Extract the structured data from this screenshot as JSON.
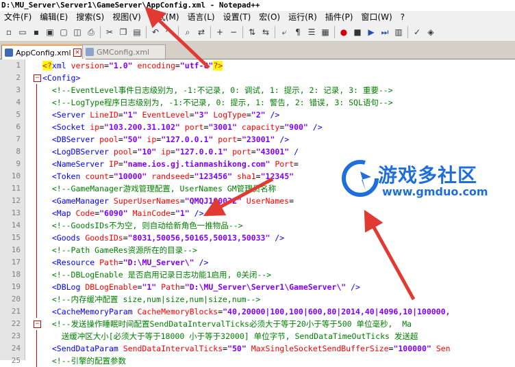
{
  "window": {
    "title": "D:\\MU_Server\\Server1\\GameServer\\AppConfig.xml - Notepad++"
  },
  "menu": [
    {
      "id": "file",
      "label": "文件(F)"
    },
    {
      "id": "edit",
      "label": "编辑(E)"
    },
    {
      "id": "search",
      "label": "搜索(S)"
    },
    {
      "id": "view",
      "label": "视图(V)"
    },
    {
      "id": "format",
      "label": "格式(M)"
    },
    {
      "id": "language",
      "label": "语言(L)"
    },
    {
      "id": "settings",
      "label": "设置(T)"
    },
    {
      "id": "macro",
      "label": "宏(O)"
    },
    {
      "id": "run",
      "label": "运行(R)"
    },
    {
      "id": "plugins",
      "label": "插件(P)"
    },
    {
      "id": "window",
      "label": "窗口(W)"
    },
    {
      "id": "help",
      "label": "?"
    }
  ],
  "tabs": [
    {
      "label": "AppConfig.xml",
      "active": true
    },
    {
      "label": "GMConfig.xml",
      "active": false
    }
  ],
  "lines": [
    {
      "n": "1",
      "fold": "",
      "segs": [
        [
          "pi",
          "<?"
        ],
        [
          "tag",
          "xml "
        ],
        [
          "attr",
          "version"
        ],
        [
          "txt",
          "="
        ],
        [
          "val",
          "\"1.0\""
        ],
        [
          "txt",
          " "
        ],
        [
          "attr",
          "encoding"
        ],
        [
          "txt",
          "="
        ],
        [
          "val",
          "\"utf-8\""
        ],
        [
          "pi",
          "?>"
        ]
      ]
    },
    {
      "n": "2",
      "fold": "minus",
      "segs": [
        [
          "tag",
          "<Config>"
        ]
      ]
    },
    {
      "n": "3",
      "fold": "line",
      "segs": [
        [
          "txt",
          "  "
        ],
        [
          "cmt",
          "<!--EventLevel事件日志级别为, -1:不记录, 0: 调试, 1: 提示, 2: 记录, 3: 重要-->"
        ]
      ]
    },
    {
      "n": "4",
      "fold": "line",
      "segs": [
        [
          "txt",
          "  "
        ],
        [
          "cmt",
          "<!--LogType程序日志级别为, -1:不记录, 0: 提示, 1: 警告, 2: 错误, 3: SQL语句-->"
        ]
      ]
    },
    {
      "n": "5",
      "fold": "line",
      "segs": [
        [
          "txt",
          "  "
        ],
        [
          "tag",
          "<Server "
        ],
        [
          "attr",
          "LineID"
        ],
        [
          "txt",
          "="
        ],
        [
          "val",
          "\"1\""
        ],
        [
          "txt",
          " "
        ],
        [
          "attr",
          "EventLevel"
        ],
        [
          "txt",
          "="
        ],
        [
          "val",
          "\"3\""
        ],
        [
          "txt",
          " "
        ],
        [
          "attr",
          "LogType"
        ],
        [
          "txt",
          "="
        ],
        [
          "val",
          "\"2\""
        ],
        [
          "tag",
          " />"
        ]
      ]
    },
    {
      "n": "6",
      "fold": "line",
      "segs": [
        [
          "txt",
          "  "
        ],
        [
          "tag",
          "<Socket "
        ],
        [
          "attr",
          "ip"
        ],
        [
          "txt",
          "="
        ],
        [
          "val",
          "\"103.200.31.102\""
        ],
        [
          "txt",
          " "
        ],
        [
          "attr",
          "port"
        ],
        [
          "txt",
          "="
        ],
        [
          "val",
          "\"3001\""
        ],
        [
          "txt",
          " "
        ],
        [
          "attr",
          "capacity"
        ],
        [
          "txt",
          "="
        ],
        [
          "val",
          "\"900\""
        ],
        [
          "tag",
          " />"
        ]
      ]
    },
    {
      "n": "7",
      "fold": "line",
      "segs": [
        [
          "txt",
          "  "
        ],
        [
          "tag",
          "<DBServer "
        ],
        [
          "attr",
          "pool"
        ],
        [
          "txt",
          "="
        ],
        [
          "val",
          "\"50\""
        ],
        [
          "txt",
          " "
        ],
        [
          "attr",
          "ip"
        ],
        [
          "txt",
          "="
        ],
        [
          "val",
          "\"127.0.0.1\""
        ],
        [
          "txt",
          " "
        ],
        [
          "attr",
          "port"
        ],
        [
          "txt",
          "="
        ],
        [
          "val",
          "\"23001\""
        ],
        [
          "tag",
          " />"
        ]
      ]
    },
    {
      "n": "8",
      "fold": "line",
      "segs": [
        [
          "txt",
          "  "
        ],
        [
          "tag",
          "<LogDBServer "
        ],
        [
          "attr",
          "pool"
        ],
        [
          "txt",
          "="
        ],
        [
          "val",
          "\"10\""
        ],
        [
          "txt",
          " "
        ],
        [
          "attr",
          "ip"
        ],
        [
          "txt",
          "="
        ],
        [
          "val",
          "\"127.0.0.1\""
        ],
        [
          "txt",
          " "
        ],
        [
          "attr",
          "port"
        ],
        [
          "txt",
          "="
        ],
        [
          "val",
          "\"43001\""
        ],
        [
          "tag",
          " /"
        ]
      ]
    },
    {
      "n": "9",
      "fold": "line",
      "segs": [
        [
          "txt",
          "  "
        ],
        [
          "tag",
          "<NameServer "
        ],
        [
          "attr",
          "IP"
        ],
        [
          "txt",
          "="
        ],
        [
          "val",
          "\"name.ios.gj.tianmashikong.com\""
        ],
        [
          "txt",
          " "
        ],
        [
          "attr",
          "Port"
        ],
        [
          "txt",
          "="
        ]
      ]
    },
    {
      "n": "10",
      "fold": "line",
      "segs": [
        [
          "txt",
          "  "
        ],
        [
          "tag",
          "<Token "
        ],
        [
          "attr",
          "count"
        ],
        [
          "txt",
          "="
        ],
        [
          "val",
          "\"10000\""
        ],
        [
          "txt",
          " "
        ],
        [
          "attr",
          "randseed"
        ],
        [
          "txt",
          "="
        ],
        [
          "val",
          "\"123456\""
        ],
        [
          "txt",
          " "
        ],
        [
          "attr",
          "sha1"
        ],
        [
          "txt",
          "="
        ],
        [
          "val",
          "\"12345\""
        ]
      ]
    },
    {
      "n": "11",
      "fold": "line",
      "segs": [
        [
          "txt",
          "  "
        ],
        [
          "cmt",
          "<!--GameManager游戏管理配置, UserNames GM管理员名称"
        ]
      ]
    },
    {
      "n": "12",
      "fold": "line",
      "segs": [
        [
          "txt",
          "  "
        ],
        [
          "tag",
          "<GameManager "
        ],
        [
          "attr",
          "SuperUserNames"
        ],
        [
          "txt",
          "="
        ],
        [
          "val",
          "\"QMQJ100032\""
        ],
        [
          "txt",
          " "
        ],
        [
          "attr",
          "UserNames"
        ],
        [
          "txt",
          "="
        ]
      ]
    },
    {
      "n": "13",
      "fold": "line",
      "segs": [
        [
          "txt",
          "  "
        ],
        [
          "tag",
          "<Map "
        ],
        [
          "attr",
          "Code"
        ],
        [
          "txt",
          "="
        ],
        [
          "val",
          "\"6090\""
        ],
        [
          "txt",
          " "
        ],
        [
          "attr",
          "MainCode"
        ],
        [
          "txt",
          "="
        ],
        [
          "val",
          "\"1\""
        ],
        [
          "tag",
          " />"
        ]
      ]
    },
    {
      "n": "14",
      "fold": "line",
      "segs": [
        [
          "txt",
          "  "
        ],
        [
          "cmt",
          "<!--GoodsIDs不为空, 则自动给新角色一推物品-->"
        ]
      ]
    },
    {
      "n": "15",
      "fold": "line",
      "segs": [
        [
          "txt",
          "  "
        ],
        [
          "tag",
          "<Goods "
        ],
        [
          "attr",
          "GoodsIDs"
        ],
        [
          "txt",
          "="
        ],
        [
          "val",
          "\"8031,50056,50165,50013,50033\""
        ],
        [
          "tag",
          " />"
        ]
      ]
    },
    {
      "n": "16",
      "fold": "line",
      "segs": [
        [
          "txt",
          "  "
        ],
        [
          "cmt",
          "<!--Path GameRes资源所在的目录-->"
        ]
      ]
    },
    {
      "n": "17",
      "fold": "line",
      "segs": [
        [
          "txt",
          "  "
        ],
        [
          "tag",
          "<Resource "
        ],
        [
          "attr",
          "Path"
        ],
        [
          "txt",
          "="
        ],
        [
          "val",
          "\"D:\\MU_Server\\\""
        ],
        [
          "tag",
          " />"
        ]
      ]
    },
    {
      "n": "18",
      "fold": "line",
      "segs": [
        [
          "txt",
          "  "
        ],
        [
          "cmt",
          "<!--DBLogEnable 是否启用记录日志功能1启用, 0关闭-->"
        ]
      ]
    },
    {
      "n": "19",
      "fold": "line",
      "segs": [
        [
          "txt",
          "  "
        ],
        [
          "tag",
          "<DBLog "
        ],
        [
          "attr",
          "DBLogEnable"
        ],
        [
          "txt",
          "="
        ],
        [
          "val",
          "\"1\""
        ],
        [
          "txt",
          " "
        ],
        [
          "attr",
          "Path"
        ],
        [
          "txt",
          "="
        ],
        [
          "val",
          "\"D:\\MU_Server\\Server1\\GameServer\\\""
        ],
        [
          "tag",
          " />"
        ]
      ]
    },
    {
      "n": "20",
      "fold": "line",
      "segs": [
        [
          "txt",
          "  "
        ],
        [
          "cmt",
          "<!--内存缓冲配置 size,num|size,num|size,num-->"
        ]
      ]
    },
    {
      "n": "21",
      "fold": "line",
      "segs": [
        [
          "txt",
          "  "
        ],
        [
          "tag",
          "<CacheMemoryParam "
        ],
        [
          "attr",
          "CacheMemoryBlocks"
        ],
        [
          "txt",
          "="
        ],
        [
          "val",
          "\"40,20000|100,100|600,80|2014,40|4096,10|100000,"
        ]
      ]
    },
    {
      "n": "22",
      "fold": "minus",
      "segs": [
        [
          "txt",
          "  "
        ],
        [
          "cmt",
          "<!--发送操作睡眠时间配置SendDataIntervalTicks必须大于等于20小于等于500 单位毫秒,  Ma"
        ]
      ]
    },
    {
      "n": "23",
      "fold": "line",
      "segs": [
        [
          "txt",
          "    "
        ],
        [
          "cmt",
          "送缓冲区大小[必须大于等于18000 小于等于32000] 单位字节, SendDataTimeOutTicks 发送超"
        ]
      ]
    },
    {
      "n": "24",
      "fold": "line",
      "segs": [
        [
          "txt",
          "  "
        ],
        [
          "tag",
          "<SendDataParam "
        ],
        [
          "attr",
          "SendDataIntervalTicks"
        ],
        [
          "txt",
          "="
        ],
        [
          "val",
          "\"50\""
        ],
        [
          "txt",
          " "
        ],
        [
          "attr",
          "MaxSingleSocketSendBufferSize"
        ],
        [
          "txt",
          "="
        ],
        [
          "val",
          "\"100000\""
        ],
        [
          "txt",
          " "
        ],
        [
          "attr",
          "Sen"
        ]
      ]
    },
    {
      "n": "25",
      "fold": "line",
      "segs": [
        [
          "txt",
          "  "
        ],
        [
          "cmt",
          "<!--引擎的配置参数"
        ]
      ]
    }
  ],
  "watermark": {
    "title": "游戏多社区",
    "url": "www.gmduo.com"
  },
  "colors": {
    "tag": "#0000ff",
    "attr": "#ff0000",
    "value": "#8000ff",
    "comment": "#008000",
    "arrow": "#e03a32",
    "watermark": "#1e6fd9"
  }
}
